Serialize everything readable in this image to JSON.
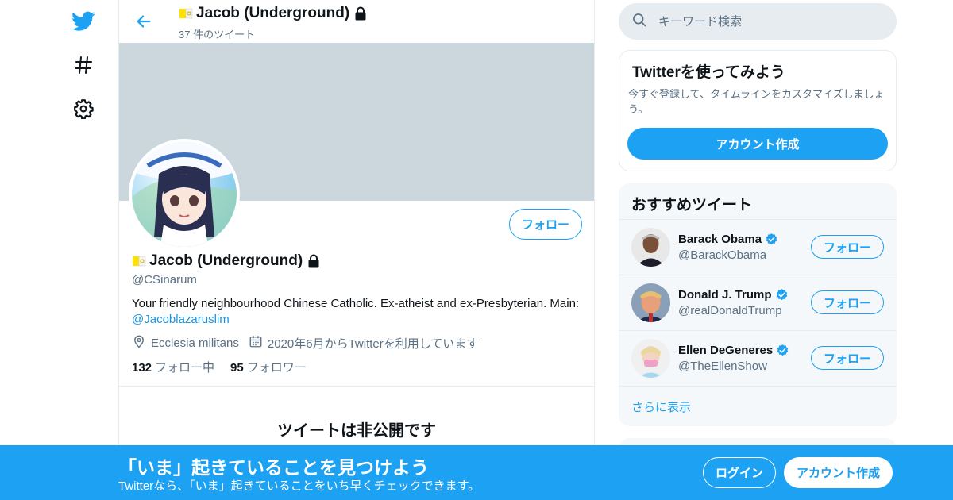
{
  "header": {
    "display_name": "Jacob (Underground)",
    "tweet_count": "37 件のツイート"
  },
  "profile": {
    "follow_label": "フォロー",
    "display_name": "Jacob (Underground)",
    "handle": "@CSinarum",
    "bio_text": "Your friendly neighbourhood Chinese Catholic. Ex-atheist and ex-Presbyterian. Main:",
    "bio_link": "@Jacoblazaruslim",
    "location": "Ecclesia militans",
    "joined": "2020年6月からTwitterを利用しています",
    "following_count": "132",
    "following_label": "フォロー中",
    "followers_count": "95",
    "followers_label": "フォロワー",
    "protected_message": "ツイートは非公開です"
  },
  "search": {
    "placeholder": "キーワード検索"
  },
  "signup_card": {
    "title": "Twitterを使ってみよう",
    "description": "今すぐ登録して、タイムラインをカスタマイズしましょう。",
    "button": "アカウント作成"
  },
  "recommended": {
    "title": "おすすめツイート",
    "follow_label": "フォロー",
    "show_more": "さらに表示",
    "accounts": [
      {
        "name": "Barack Obama",
        "handle": "@BarackObama"
      },
      {
        "name": "Donald J. Trump",
        "handle": "@realDonaldTrump"
      },
      {
        "name": "Ellen DeGeneres",
        "handle": "@TheEllenShow"
      }
    ]
  },
  "bottom_bar": {
    "title": "「いま」起きていることを見つけよう",
    "subtitle": "Twitterなら、「いま」起きていることをいち早くチェックできます。",
    "login": "ログイン",
    "signup": "アカウント作成"
  },
  "nav": {
    "icons": [
      "twitter-logo-icon",
      "hashtag-icon",
      "settings-gear-icon"
    ]
  },
  "colors": {
    "accent": "#1da1f2",
    "banner": "#ccd6dd",
    "secondary_text": "#5b7083"
  }
}
